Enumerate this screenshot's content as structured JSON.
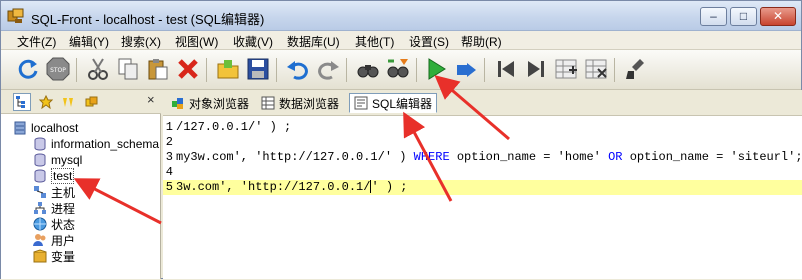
{
  "window": {
    "title": "SQL-Front - localhost - test  (SQL编辑器)",
    "minimize_label": "–",
    "maximize_label": "□",
    "close_label": "✕"
  },
  "menubar": {
    "items": [
      "文件(Z)",
      "编辑(Y)",
      "搜索(X)",
      "视图(W)",
      "收藏(V)",
      "数据库(U)",
      "其他(T)",
      "设置(S)",
      "帮助(R)"
    ]
  },
  "toolbar": {
    "buttons": [
      "refresh-icon",
      "stop-icon",
      "cut-icon",
      "copy-icon",
      "paste-icon",
      "delete-icon",
      "open-icon",
      "save-icon",
      "undo-icon",
      "redo-icon",
      "binoculars-icon",
      "find-replace-icon",
      "run-icon",
      "run-selection-icon",
      "first-record-icon",
      "last-record-icon",
      "insert-record-icon",
      "delete-record-icon",
      "clear-icon"
    ]
  },
  "leftpanel": {
    "tabs": [
      "tree-icon",
      "favorites-icon",
      "sql-history-icon",
      "objects-icon"
    ],
    "close_label": "×",
    "tree": [
      {
        "label": "localhost",
        "icon": "server-icon",
        "level": 0
      },
      {
        "label": "information_schema",
        "icon": "database-icon",
        "level": 1
      },
      {
        "label": "mysql",
        "icon": "database-icon",
        "level": 1
      },
      {
        "label": "test",
        "icon": "database-icon",
        "level": 1
      },
      {
        "label": "主机",
        "icon": "hosts-icon",
        "level": 1
      },
      {
        "label": "进程",
        "icon": "processes-icon",
        "level": 1
      },
      {
        "label": "状态",
        "icon": "status-icon",
        "level": 1
      },
      {
        "label": "用户",
        "icon": "users-icon",
        "level": 1
      },
      {
        "label": "变量",
        "icon": "variables-icon",
        "level": 1
      }
    ]
  },
  "rightpanel": {
    "tabs": [
      {
        "label": "对象浏览器",
        "icon": "object-browser-icon",
        "active": false
      },
      {
        "label": "数据浏览器",
        "icon": "data-browser-icon",
        "active": false
      },
      {
        "label": "SQL编辑器",
        "icon": "sql-editor-icon",
        "active": true
      }
    ]
  },
  "editor": {
    "lines": [
      {
        "num": "1",
        "text": "/127.0.0.1/' ) ;",
        "highlight": false
      },
      {
        "num": "2",
        "text": "",
        "highlight": false
      },
      {
        "num": "3",
        "text": "my3w.com', 'http://127.0.0.1/' ) WHERE option_name = 'home' OR option_name = 'siteurl';",
        "highlight": false
      },
      {
        "num": "4",
        "text": "",
        "highlight": false
      },
      {
        "num": "5",
        "text": "3w.com', 'http://127.0.0.1/' ) ;",
        "highlight": true
      }
    ]
  },
  "colors": {
    "annotation_arrow": "#e8302a",
    "highlight_line": "#ffff9e",
    "keyword": "#0000ff"
  }
}
